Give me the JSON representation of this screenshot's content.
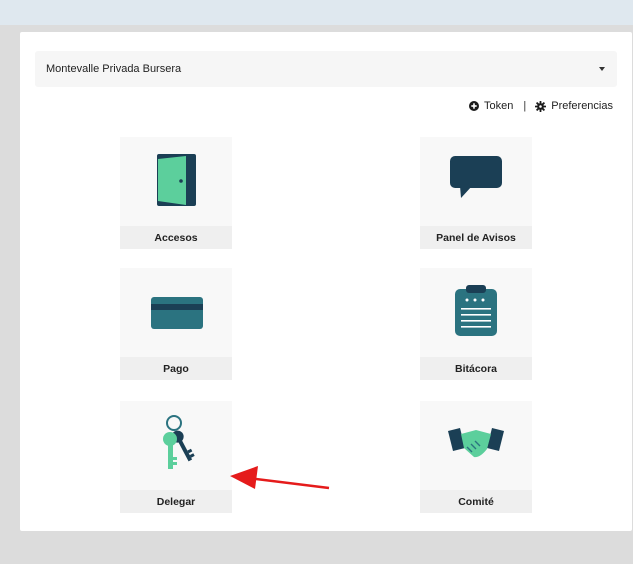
{
  "property_select": {
    "value": "Montevalle Privada Bursera"
  },
  "links": {
    "token_label": "Token",
    "separator": "|",
    "preferences_label": "Preferencias"
  },
  "tiles": [
    {
      "label": "Accesos",
      "icon": "door-icon"
    },
    {
      "label": "Panel de Avisos",
      "icon": "speech-bubble-icon"
    },
    {
      "label": "Pago",
      "icon": "credit-card-icon"
    },
    {
      "label": "Bitácora",
      "icon": "clipboard-icon"
    },
    {
      "label": "Delegar",
      "icon": "keys-icon"
    },
    {
      "label": "Comité",
      "icon": "handshake-icon"
    }
  ],
  "colors": {
    "icon_dark": "#1b3f55",
    "icon_teal": "#2b7380",
    "icon_green": "#5ccf9c",
    "annotation_arrow": "#e51b1b"
  }
}
